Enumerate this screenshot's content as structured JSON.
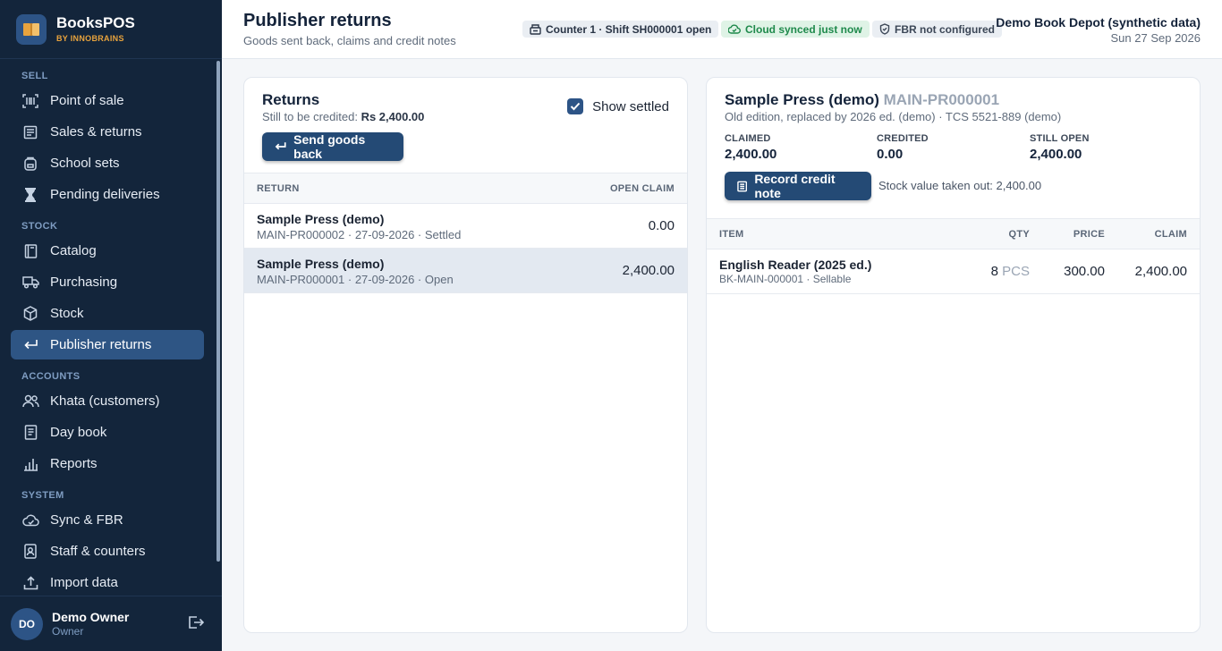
{
  "brand": {
    "name": "BooksPOS",
    "sub": "BY INNOBRAINS",
    "accent": "#e8a33d"
  },
  "sidebar": {
    "sections": [
      {
        "label": "SELL",
        "items": [
          {
            "label": "Point of sale",
            "icon": "barcode-icon"
          },
          {
            "label": "Sales & returns",
            "icon": "receipt-icon"
          },
          {
            "label": "School sets",
            "icon": "backpack-icon"
          },
          {
            "label": "Pending deliveries",
            "icon": "hourglass-icon"
          }
        ]
      },
      {
        "label": "STOCK",
        "items": [
          {
            "label": "Catalog",
            "icon": "book-icon"
          },
          {
            "label": "Purchasing",
            "icon": "truck-icon"
          },
          {
            "label": "Stock",
            "icon": "box-icon"
          },
          {
            "label": "Publisher returns",
            "icon": "return-arrow-icon",
            "active": true
          }
        ]
      },
      {
        "label": "ACCOUNTS",
        "items": [
          {
            "label": "Khata (customers)",
            "icon": "users-icon"
          },
          {
            "label": "Day book",
            "icon": "ledger-icon"
          },
          {
            "label": "Reports",
            "icon": "bar-chart-icon"
          }
        ]
      },
      {
        "label": "SYSTEM",
        "items": [
          {
            "label": "Sync & FBR",
            "icon": "cloud-sync-icon"
          },
          {
            "label": "Staff & counters",
            "icon": "id-badge-icon"
          },
          {
            "label": "Import data",
            "icon": "upload-icon"
          }
        ]
      }
    ]
  },
  "user": {
    "initials": "DO",
    "name": "Demo Owner",
    "role": "Owner"
  },
  "header": {
    "title": "Publisher returns",
    "subtitle": "Goods sent back, claims and credit notes",
    "counter_pill": "Counter 1 · Shift SH000001 open",
    "cloud_pill": "Cloud synced just now",
    "fbr_pill": "FBR not configured",
    "store_name": "Demo Book Depot (synthetic data)",
    "date": "Sun 27 Sep 2026"
  },
  "returns": {
    "title": "Returns",
    "sub_prefix": "Still to be credited: ",
    "sub_amount": "Rs 2,400.00",
    "show_settled_label": "Show settled",
    "show_settled_checked": true,
    "send_button": "Send goods back",
    "col_return": "RETURN",
    "col_open_claim": "OPEN CLAIM",
    "rows": [
      {
        "title": "Sample Press (demo)",
        "meta": "MAIN-PR000002 · 27-09-2026 · Settled",
        "amount": "0.00",
        "selected": false
      },
      {
        "title": "Sample Press (demo)",
        "meta": "MAIN-PR000001 · 27-09-2026 · Open",
        "amount": "2,400.00",
        "selected": true
      }
    ]
  },
  "detail": {
    "publisher": "Sample Press (demo)",
    "code": "MAIN-PR000001",
    "subtitle": "Old edition, replaced by 2026 ed. (demo) · TCS 5521-889 (demo)",
    "stats": [
      {
        "label": "CLAIMED",
        "value": "2,400.00"
      },
      {
        "label": "CREDITED",
        "value": "0.00"
      },
      {
        "label": "STILL OPEN",
        "value": "2,400.00"
      }
    ],
    "record_button": "Record credit note",
    "stock_note": "Stock value taken out: 2,400.00",
    "columns": {
      "item": "ITEM",
      "qty": "QTY",
      "price": "PRICE",
      "claim": "CLAIM"
    },
    "items": [
      {
        "name": "English Reader (2025 ed.)",
        "meta": "BK-MAIN-000001 · Sellable",
        "qty": "8",
        "unit": "PCS",
        "price": "300.00",
        "claim": "2,400.00"
      }
    ]
  }
}
